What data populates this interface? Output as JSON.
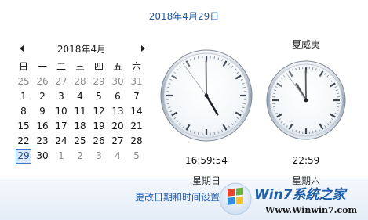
{
  "header": {
    "date_long": "2018年4月29日"
  },
  "calendar": {
    "month_title": "2018年4月",
    "weekdays": [
      "日",
      "一",
      "二",
      "三",
      "四",
      "五",
      "六"
    ],
    "weeks": [
      [
        "25",
        "26",
        "27",
        "28",
        "29",
        "30",
        "31"
      ],
      [
        "1",
        "2",
        "3",
        "4",
        "5",
        "6",
        "7"
      ],
      [
        "8",
        "9",
        "10",
        "11",
        "12",
        "13",
        "14"
      ],
      [
        "15",
        "16",
        "17",
        "18",
        "19",
        "20",
        "21"
      ],
      [
        "22",
        "23",
        "24",
        "25",
        "26",
        "27",
        "28"
      ],
      [
        "29",
        "30",
        "1",
        "2",
        "3",
        "4",
        "5"
      ]
    ],
    "today": "29",
    "prev_icon": "triangle-left-icon",
    "next_icon": "triangle-right-icon"
  },
  "clocks": [
    {
      "label": "",
      "time": "16:59:54",
      "day": "星期日",
      "hour": 16,
      "minute": 59,
      "second": 54
    },
    {
      "label": "夏威夷",
      "time": "22:59",
      "day": "星期六",
      "hour": 22,
      "minute": 59,
      "second": 54
    }
  ],
  "footer": {
    "change_link": "更改日期和时间设置..."
  },
  "watermark": {
    "brand_text": "Win7系统之家",
    "url": "Www.Winwin7.com"
  },
  "colors": {
    "link": "#1e5aa8",
    "today_border": "#3a78c9",
    "other_month": "#8a8a8a"
  }
}
